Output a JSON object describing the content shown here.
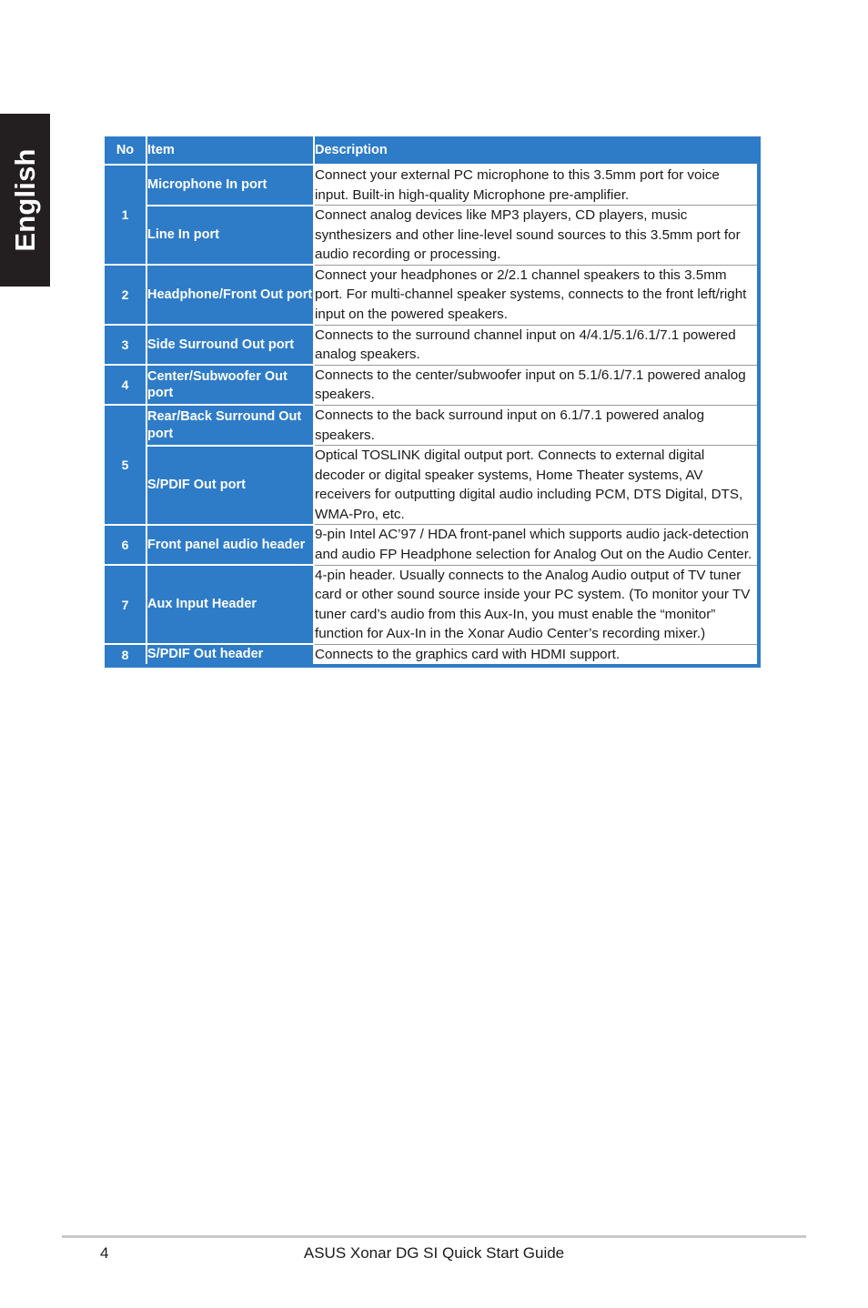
{
  "page": {
    "language_tab": "English",
    "footer": {
      "page_number": "4",
      "document_title": "ASUS Xonar DG SI Quick Start Guide"
    },
    "colors": {
      "accent_blue": "#2E7CC8",
      "tab_black": "#231F20",
      "rule_gray": "#C9C9C9",
      "text_black": "#1A1A1A"
    }
  },
  "table": {
    "headers": {
      "no": "No",
      "item": "Item",
      "description": "Description"
    },
    "rows": [
      {
        "no": "1",
        "rowspan": 2,
        "entries": [
          {
            "item": "Microphone In port",
            "description": "Connect your external PC microphone to this 3.5mm port for voice input. Built-in high-quality Microphone pre-amplifier."
          },
          {
            "item": "Line In port",
            "description": "Connect analog devices like MP3 players, CD players, music synthesizers and other line-level sound sources to this 3.5mm port for audio recording or processing."
          }
        ]
      },
      {
        "no": "2",
        "rowspan": 1,
        "entries": [
          {
            "item": "Headphone/Front Out port",
            "description": "Connect your headphones or 2/2.1 channel speakers to this 3.5mm port. For multi-channel speaker systems, connects to the front left/right input on the powered speakers."
          }
        ]
      },
      {
        "no": "3",
        "rowspan": 1,
        "entries": [
          {
            "item": "Side Surround Out port",
            "description": "Connects to the surround channel input on 4/4.1/5.1/6.1/7.1 powered analog speakers."
          }
        ]
      },
      {
        "no": "4",
        "rowspan": 1,
        "entries": [
          {
            "item": "Center/Subwoofer Out port",
            "description": "Connects to the center/subwoofer input on 5.1/6.1/7.1 powered analog speakers."
          }
        ]
      },
      {
        "no": "5",
        "rowspan": 2,
        "entries": [
          {
            "item": "Rear/Back Surround Out port",
            "description": "Connects to the back surround input on 6.1/7.1 powered analog speakers."
          },
          {
            "item": "S/PDIF Out port",
            "description": "Optical TOSLINK digital output port. Connects to external digital decoder or digital speaker systems, Home Theater systems, AV receivers for outputting digital audio including PCM, DTS Digital, DTS, WMA-Pro, etc."
          }
        ]
      },
      {
        "no": "6",
        "rowspan": 1,
        "entries": [
          {
            "item": "Front panel audio header",
            "description": "9-pin Intel AC’97 / HDA front-panel which supports audio jack-detection and audio FP Headphone selection for Analog Out on the Audio Center."
          }
        ]
      },
      {
        "no": "7",
        "rowspan": 1,
        "entries": [
          {
            "item": "Aux Input Header",
            "description": "4-pin header. Usually connects to the Analog Audio output of TV tuner card or other sound source inside your PC system. (To monitor your TV tuner card’s audio from this Aux-In, you must enable the “monitor” function for Aux-In in the Xonar Audio Center’s recording mixer.)"
          }
        ]
      },
      {
        "no": "8",
        "rowspan": 1,
        "entries": [
          {
            "item": "S/PDIF Out header",
            "description": "Connects to the graphics card with HDMI support."
          }
        ]
      }
    ]
  }
}
